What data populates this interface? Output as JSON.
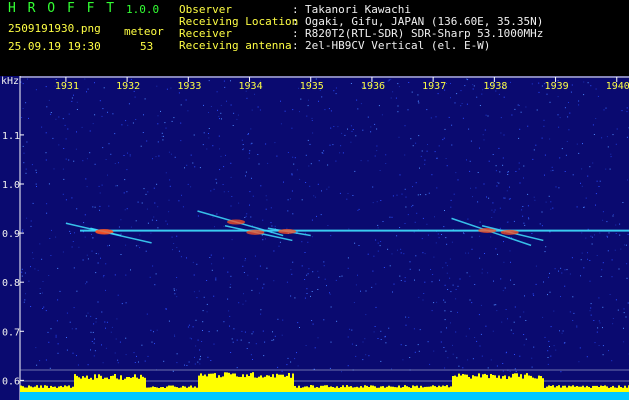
{
  "app": {
    "name": "H R O F F T",
    "version": "1.0.0"
  },
  "file": {
    "name": "2509191930.png",
    "datetime": "25.09.19 19:30"
  },
  "detection": {
    "label": "meteor",
    "count": "53"
  },
  "info": {
    "labels": [
      "Observer",
      "Receiving Location",
      "Receiver",
      "Receiving antenna"
    ],
    "separator": ":",
    "values": [
      "Takanori Kawachi",
      "Ogaki, Gifu, JAPAN (136.60E, 35.35N)",
      "R820T2(RTL-SDR) SDR-Sharp 53.1000MHz",
      "2el-HB9CV Vertical (el. E-W)"
    ]
  },
  "colors": {
    "title": "#33ff33",
    "label": "#ffff44",
    "text": "#f0f0f0",
    "background": "#0a0a70",
    "trace": "#40e0ff",
    "hot": "#ff5020",
    "power": "#ffff00",
    "base": "#00c8ff"
  },
  "chart_data": {
    "type": "heatmap",
    "ylabel": "kHz",
    "x_ticks": [
      "1931",
      "1932",
      "1933",
      "1934",
      "1935",
      "1936",
      "1937",
      "1938",
      "1939",
      "1940"
    ],
    "y_ticks": [
      "1.1",
      "1.0",
      "0.9",
      "0.8",
      "0.7",
      "0.6"
    ],
    "ylim": [
      0.56,
      1.22
    ],
    "xlim": [
      1930.25,
      1940.2
    ],
    "carrier_khz": 0.905,
    "meteor_traces": [
      {
        "x_start": 1931.0,
        "x_end": 1932.4,
        "khz_start": 0.92,
        "khz_end": 0.88
      },
      {
        "x_start": 1931.4,
        "x_end": 1931.9,
        "khz_start": 0.91,
        "khz_end": 0.895
      },
      {
        "x_start": 1933.15,
        "x_end": 1934.55,
        "khz_start": 0.945,
        "khz_end": 0.895
      },
      {
        "x_start": 1933.6,
        "x_end": 1934.7,
        "khz_start": 0.915,
        "khz_end": 0.885
      },
      {
        "x_start": 1934.3,
        "x_end": 1935.0,
        "khz_start": 0.91,
        "khz_end": 0.895
      },
      {
        "x_start": 1937.3,
        "x_end": 1938.6,
        "khz_start": 0.93,
        "khz_end": 0.875
      },
      {
        "x_start": 1937.8,
        "x_end": 1938.8,
        "khz_start": 0.915,
        "khz_end": 0.885
      }
    ],
    "grid": false,
    "legend": "none"
  }
}
